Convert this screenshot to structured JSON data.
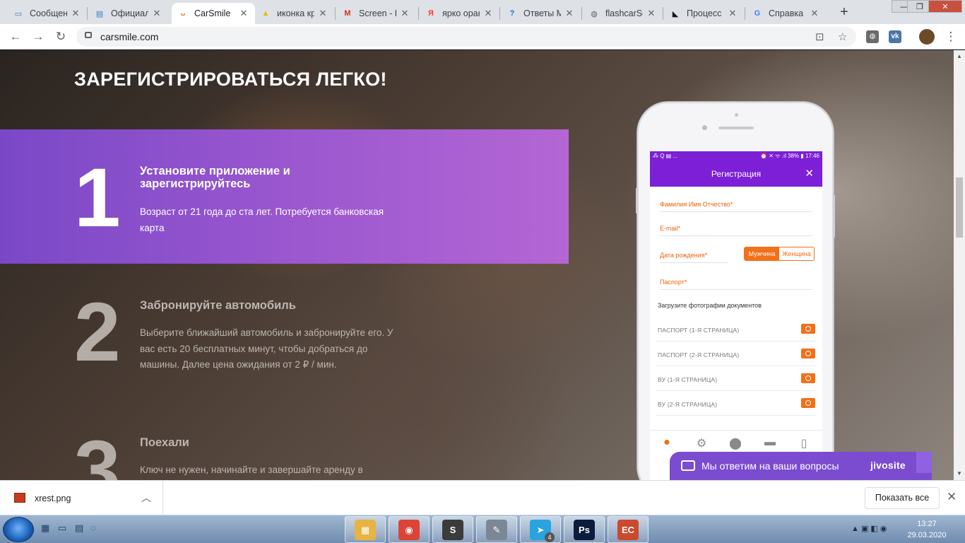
{
  "browser": {
    "tabs": [
      {
        "title": "Сообщения",
        "icon": "vk-messages-icon",
        "color": "#4a76a8",
        "glyph": "▭"
      },
      {
        "title": "Официальный",
        "icon": "document-icon",
        "color": "#3c7cc4",
        "glyph": "▤"
      },
      {
        "title": "CarSmile",
        "icon": "carsmile-icon",
        "color": "#f36f18",
        "glyph": "ᴗ"
      },
      {
        "title": "иконка кр",
        "icon": "image-icon",
        "color": "#e7b900",
        "glyph": "▲"
      },
      {
        "title": "Screen - K",
        "icon": "gmail-icon",
        "color": "#d93025",
        "glyph": "M"
      },
      {
        "title": "ярко оранж",
        "icon": "yandex-icon",
        "color": "#fc3f1d",
        "glyph": "Я"
      },
      {
        "title": "Ответы Mail",
        "icon": "question-icon",
        "color": "#1a6fd1",
        "glyph": "?"
      },
      {
        "title": "flashcarSo",
        "icon": "globe-icon",
        "color": "#5f6368",
        "glyph": "◍"
      },
      {
        "title": "Процесс",
        "icon": "triangle-icon",
        "color": "#111111",
        "glyph": "◣"
      },
      {
        "title": "Справка",
        "icon": "google-icon",
        "color": "#4285f4",
        "glyph": "G"
      }
    ],
    "active_tab": 2,
    "new_tab_label": "+",
    "window_controls": {
      "minimize": "—",
      "maximize": "❐",
      "close": "✕"
    },
    "nav": {
      "back": "←",
      "forward": "→",
      "reload": "↻"
    },
    "url": "carsmile.com",
    "omnibox_icons": {
      "translate": "⊡",
      "bookmark": "☆"
    },
    "extensions": [
      {
        "name": "globe-extension-icon",
        "color": "#6b6b6b",
        "glyph": "◍"
      },
      {
        "name": "vk-extension-icon",
        "color": "#4a76a8",
        "glyph": "vk"
      },
      {
        "name": "profile-avatar",
        "color": "#6b4a2a",
        "glyph": ""
      }
    ],
    "menu": "⋮"
  },
  "page": {
    "heading": "ЗАРЕГИСТРИРОВАТЬСЯ ЛЕГКО!",
    "steps": [
      {
        "number": "1",
        "title": "Установите приложение и зарегистрируйтесь",
        "text": "Возраст от 21 года до ста лет. Потребуется банковская карта"
      },
      {
        "number": "2",
        "title": "Забронируйте автомобиль",
        "text": "Выберите ближайший автомобиль и забронируйте его. У вас есть 20 бесплатных минут, чтобы добраться до машины. Далее цена ожидания от 2 ₽ / мин."
      },
      {
        "number": "3",
        "title": "Поехали",
        "text": "Ключ не нужен, начинайте и завершайте аренду в"
      }
    ]
  },
  "phone_app": {
    "status_left": "⁂ Q ▤ ...",
    "status_right": "⏰ ✕ ᯤ .ıl 38% ▮ 17:46",
    "title": "Регистрация",
    "close": "✕",
    "fields": {
      "name": "Фамилия Имя Отчество*",
      "email": "E-mail*",
      "birth": "Дата рождения*",
      "passport": "Паспорт*"
    },
    "gender": {
      "male": "Мужчина",
      "female": "Женщина",
      "selected": "Мужчина"
    },
    "docs_heading": "Загрузите фотографии документов",
    "docs": [
      "ПАСПОРТ (1-Я СТРАНИЦА)",
      "ПАСПОРТ (2-Я СТРАНИЦА)",
      "ВУ (1-Я СТРАНИЦА)",
      "ВУ (2-Я СТРАНИЦА)"
    ],
    "bottom_nav": [
      "profile-icon",
      "settings-icon",
      "location-pin-icon",
      "chat-icon",
      "phone-icon"
    ],
    "accent": "#f36f18",
    "primary": "#7c1fd6"
  },
  "chat_widget": {
    "text": "Мы ответим на ваши вопросы",
    "brand": "jivosite"
  },
  "downloads": {
    "file": "xrest.png",
    "show_all": "Показать все",
    "close": "✕"
  },
  "taskbar": {
    "apps": [
      {
        "name": "explorer",
        "color": "#e5b443",
        "glyph": "▦"
      },
      {
        "name": "chrome",
        "color": "#db4437",
        "glyph": "◉"
      },
      {
        "name": "sublime-text",
        "color": "#3b3b3b",
        "glyph": "S"
      },
      {
        "name": "pen-tool",
        "color": "#7b8794",
        "glyph": "✎"
      },
      {
        "name": "telegram",
        "color": "#2aa3e0",
        "glyph": "➤"
      },
      {
        "name": "photoshop",
        "color": "#0b1c3d",
        "glyph": "Ps"
      },
      {
        "name": "presentation",
        "color": "#c94a2c",
        "glyph": "EC"
      }
    ],
    "telegram_badge": "4",
    "time": "13:27",
    "date": "29.03.2020"
  }
}
